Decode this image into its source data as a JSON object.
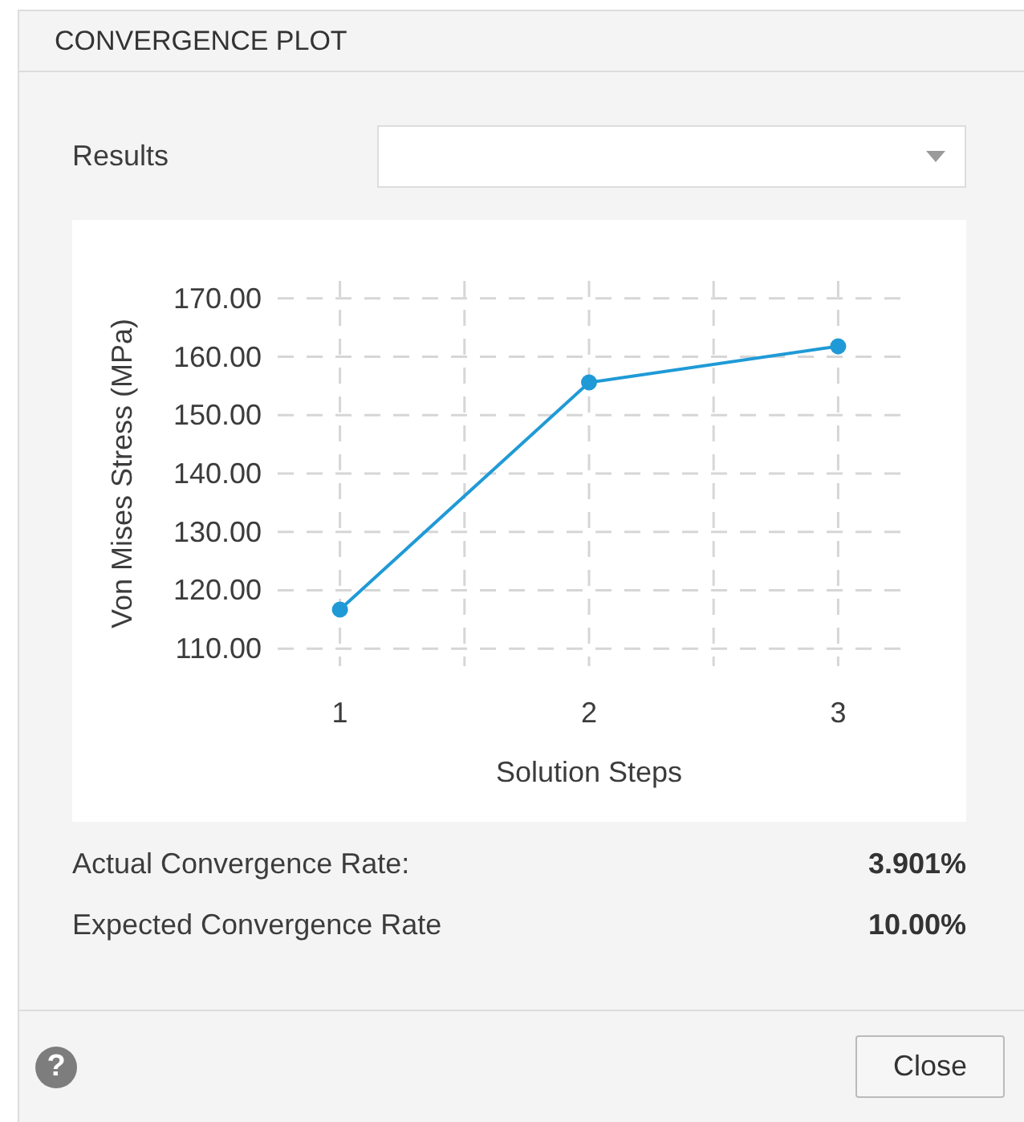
{
  "window": {
    "title": "CONVERGENCE PLOT"
  },
  "results": {
    "label": "Results",
    "expanded": false
  },
  "chart": {
    "chart_data": {
      "type": "line",
      "xlabel": "Solution Steps",
      "ylabel": "Von Mises Stress (MPa)",
      "x": [
        1,
        2,
        3
      ],
      "grid": true,
      "series": [
        {
          "color": "#1f9ad6",
          "marker": "circle",
          "values": [
            116.7,
            155.6,
            161.8
          ]
        }
      ],
      "xlim": [
        0.75,
        3.25
      ],
      "ylim": [
        107,
        173
      ],
      "xticks": [
        1,
        2,
        3
      ],
      "yticks": [
        {
          "value": 110,
          "label": "110.00"
        },
        {
          "value": 120,
          "label": "120.00"
        },
        {
          "value": 130,
          "label": "130.00"
        },
        {
          "value": 140,
          "label": "140.00"
        },
        {
          "value": 150,
          "label": "150.00"
        },
        {
          "value": 160,
          "label": "160.00"
        },
        {
          "value": 170,
          "label": "170.00"
        }
      ]
    }
  },
  "rates": [
    {
      "label": "Actual Convergence Rate:",
      "value": "3.901%"
    },
    {
      "label": "Expected Convergence Rate",
      "value": "10.00%"
    }
  ],
  "footer": {
    "help": "?",
    "buttons": [
      "Close"
    ]
  }
}
